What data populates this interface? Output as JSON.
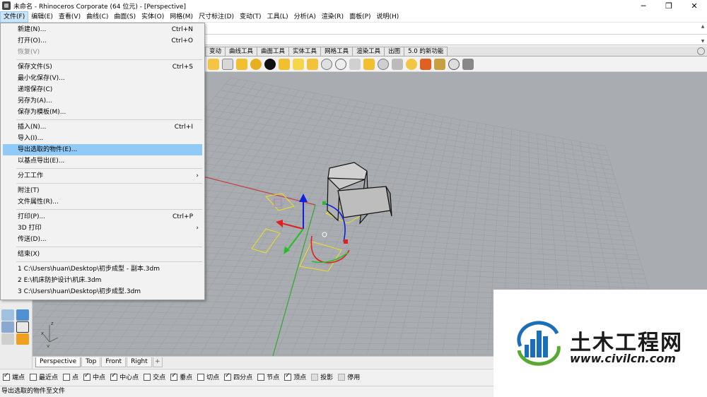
{
  "window": {
    "title": "未命名 - Rhinoceros Corporate (64 位元) - [Perspective]",
    "minimize": "─",
    "restore": "❐",
    "close": "✕"
  },
  "menubar": [
    "文件(F)",
    "编辑(E)",
    "查看(V)",
    "曲线(C)",
    "曲面(S)",
    "实体(O)",
    "网格(M)",
    "尺寸标注(D)",
    "变动(T)",
    "工具(L)",
    "分析(A)",
    "渲染(R)",
    "面板(P)",
    "说明(H)"
  ],
  "toolbar_tabs": [
    "变动",
    "曲线工具",
    "曲面工具",
    "实体工具",
    "网格工具",
    "渲染工具",
    "出图",
    "5.0 的新功能"
  ],
  "file_menu": {
    "new": {
      "label": "新建(N)...",
      "shortcut": "Ctrl+N"
    },
    "open": {
      "label": "打开(O)...",
      "shortcut": "Ctrl+O"
    },
    "revert": {
      "label": "恢复(V)"
    },
    "save": {
      "label": "保存文件(S)",
      "shortcut": "Ctrl+S"
    },
    "save_small": {
      "label": "最小化保存(V)..."
    },
    "incremental_save": {
      "label": "递增保存(C)"
    },
    "save_as": {
      "label": "另存为(A)..."
    },
    "save_template": {
      "label": "保存为模板(M)..."
    },
    "insert": {
      "label": "插入(N)...",
      "shortcut": "Ctrl+I"
    },
    "import": {
      "label": "导入(I)..."
    },
    "export_selected": {
      "label": "导出选取的物件(E)..."
    },
    "export_base": {
      "label": "以基点导出(E)..."
    },
    "worksession": {
      "label": "分工工作",
      "arrow": "›"
    },
    "notes": {
      "label": "附注(T)"
    },
    "properties": {
      "label": "文件属性(R)..."
    },
    "print": {
      "label": "打印(P)...",
      "shortcut": "Ctrl+P"
    },
    "print3d": {
      "label": "3D 打印",
      "arrow": "›"
    },
    "send": {
      "label": "传送(D)..."
    },
    "exit": {
      "label": "结束(X)"
    },
    "recent": [
      "1 C:\\Users\\huan\\Desktop\\初步成型 - 副本.3dm",
      "2 E:\\机床防护设计\\机床.3dm",
      "3 C:\\Users\\huan\\Desktop\\初步成型.3dm"
    ]
  },
  "viewport_tabs": [
    "Perspective",
    "Top",
    "Front",
    "Right"
  ],
  "viewport_add": "+",
  "gizmo": {
    "x": "x",
    "y": "y",
    "z": "z"
  },
  "osnaps": [
    {
      "label": "端点",
      "checked": true
    },
    {
      "label": "最近点",
      "checked": false
    },
    {
      "label": "点",
      "checked": false
    },
    {
      "label": "中点",
      "checked": true
    },
    {
      "label": "中心点",
      "checked": true
    },
    {
      "label": "交点",
      "checked": false
    },
    {
      "label": "垂点",
      "checked": true
    },
    {
      "label": "切点",
      "checked": false
    },
    {
      "label": "四分点",
      "checked": true
    },
    {
      "label": "节点",
      "checked": false
    },
    {
      "label": "顶点",
      "checked": true
    },
    {
      "label": "投影",
      "checked": false,
      "gray": true
    },
    {
      "label": "停用",
      "checked": false,
      "gray": true
    }
  ],
  "status": "导出选取的物件至文件",
  "watermark": {
    "title": "土木工程网",
    "url": "www.civilcn.com"
  },
  "colors": {
    "highlight": "#91c9f7",
    "viewport_bg": "#a9acb0",
    "grid": "#9a9da1",
    "x_axis": "#c04040",
    "y_axis": "#2faa2f",
    "selection": "#f0e020",
    "logo_blue": "#1b6fb8",
    "logo_green": "#5aa832"
  }
}
